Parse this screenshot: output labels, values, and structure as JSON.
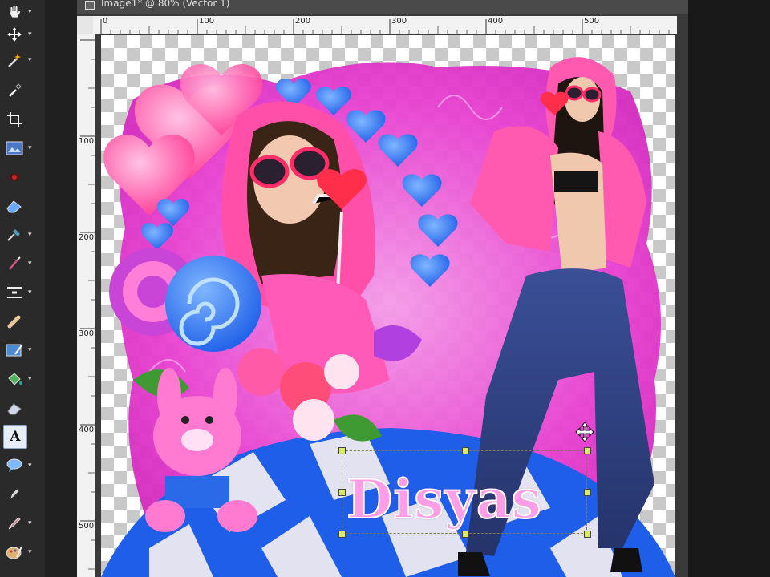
{
  "document": {
    "title": "Image1* @ 80% (Vector 1)"
  },
  "rulers": {
    "horizontal": [
      "0",
      "100",
      "200",
      "300",
      "400",
      "500"
    ],
    "vertical": [
      "100",
      "200",
      "300",
      "400",
      "500"
    ]
  },
  "tools": [
    {
      "name": "pan-tool",
      "icon": "hand-icon"
    },
    {
      "name": "move-tool",
      "icon": "move-arrows-icon"
    },
    {
      "name": "magic-wand-tool",
      "icon": "magic-wand-icon"
    },
    {
      "name": "dropper-tool",
      "icon": "dropper-icon"
    },
    {
      "name": "crop-tool",
      "icon": "crop-icon"
    },
    {
      "name": "image-tool",
      "icon": "image-icon"
    },
    {
      "name": "red-eye-tool",
      "icon": "eye-icon"
    },
    {
      "name": "eraser-tool",
      "icon": "eraser-icon"
    },
    {
      "name": "clone-tool",
      "icon": "clone-icon"
    },
    {
      "name": "paint-brush-tool",
      "icon": "brush-icon"
    },
    {
      "name": "warp-tool",
      "icon": "warp-icon"
    },
    {
      "name": "smudge-tool",
      "icon": "smudge-icon"
    },
    {
      "name": "retouch-tool",
      "icon": "retouch-icon"
    },
    {
      "name": "fill-tool",
      "icon": "bucket-icon"
    },
    {
      "name": "background-eraser-tool",
      "icon": "bg-eraser-icon"
    },
    {
      "name": "text-tool",
      "icon": "text-icon",
      "label": "A"
    },
    {
      "name": "preset-shape-tool",
      "icon": "speech-bubble-icon"
    },
    {
      "name": "pen-tool",
      "icon": "pen-icon"
    },
    {
      "name": "art-brush-tool",
      "icon": "art-brush-icon"
    },
    {
      "name": "oil-brush-tool",
      "icon": "palette-icon"
    }
  ],
  "canvas": {
    "text_layer": "Disyas",
    "zoom": "80%"
  },
  "colors": {
    "magenta": "#e83fd0",
    "pink": "#ff5aa8",
    "blue": "#1e5ee8",
    "jeans": "#2c3d7a"
  }
}
